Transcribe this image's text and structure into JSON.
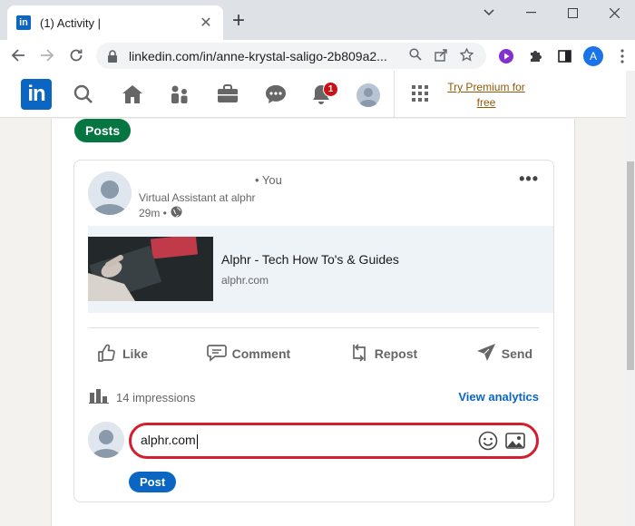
{
  "browser": {
    "tab_title": "(1) Activity |",
    "tab_favicon": "in",
    "url": "linkedin.com/in/anne-krystal-saligo-2b809a2...",
    "profile_initial": "A"
  },
  "linkedin": {
    "logo": "in",
    "notification_count": "1",
    "premium_line1": "Try Premium for",
    "premium_line2": "free"
  },
  "page": {
    "posts_label": "Posts"
  },
  "post": {
    "you_label": "• You",
    "headline": "Virtual Assistant at alphr",
    "time": "29m •",
    "more": "•••",
    "link_title": "Alphr - Tech How To's & Guides",
    "link_domain": "alphr.com",
    "actions": {
      "like": "Like",
      "comment": "Comment",
      "repost": "Repost",
      "send": "Send"
    },
    "impressions": "14 impressions",
    "view_analytics": "View analytics"
  },
  "comment": {
    "value": "alphr.com",
    "post_label": "Post"
  },
  "colors": {
    "linkedin_blue": "#0a66c2",
    "posts_green": "#057642",
    "highlight_red": "#d21f2f",
    "premium_gold": "#915907"
  }
}
